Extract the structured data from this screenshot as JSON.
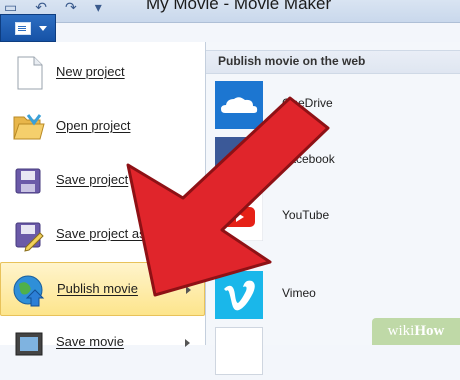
{
  "window": {
    "title": "My Movie - Movie Maker"
  },
  "menu": {
    "items": [
      {
        "label": "New project",
        "icon": "new-document-icon"
      },
      {
        "label": "Open project",
        "icon": "open-folder-icon"
      },
      {
        "label": "Save project",
        "icon": "save-disk-icon"
      },
      {
        "label": "Save project as",
        "icon": "save-as-icon"
      },
      {
        "label": "Publish movie",
        "icon": "globe-icon",
        "highlighted": true
      },
      {
        "label": "Save movie",
        "icon": "film-icon"
      }
    ]
  },
  "publish_panel": {
    "header": "Publish movie on the web",
    "services": [
      {
        "name": "OneDrive",
        "icon": "cloud-icon",
        "color": "#1c76d1"
      },
      {
        "name": "Facebook",
        "icon": "facebook-icon",
        "color": "#3b5998"
      },
      {
        "name": "YouTube",
        "icon": "youtube-icon",
        "color": "#ffffff"
      },
      {
        "name": "Vimeo",
        "icon": "vimeo-icon",
        "color": "#1ab7ea"
      },
      {
        "name": "",
        "icon": "blank-tile-icon",
        "color": "#ffffff"
      }
    ]
  },
  "watermark": {
    "prefix": "wiki",
    "suffix": "How"
  },
  "colors": {
    "accent": "#1652a6",
    "highlight": "#fde58c",
    "arrow": "#e0252b"
  }
}
